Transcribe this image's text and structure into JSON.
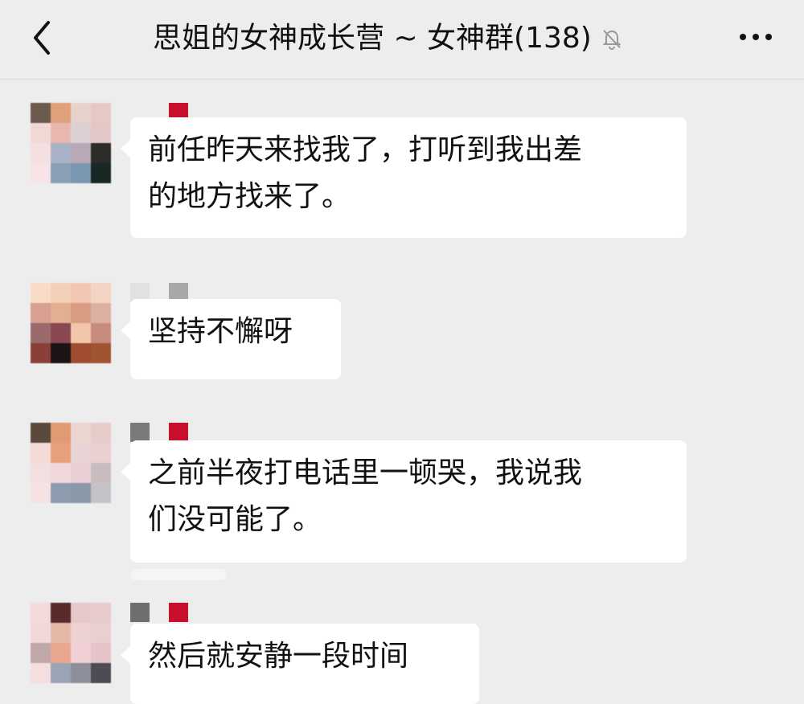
{
  "header": {
    "title": "思姐的女神成长营 ~ 女神群(138)",
    "back_icon": "chevron-left-icon",
    "mute_icon": "bell-off-icon",
    "more_icon": "more-horizontal-icon"
  },
  "messages": [
    {
      "text_lines": [
        "前任昨天来找我了，打听到我出差",
        "的地方找来了。"
      ]
    },
    {
      "text_lines": [
        "坚持不懈呀"
      ]
    },
    {
      "text_lines": [
        "之前半夜打电话里一顿哭，我说我",
        "们没可能了。"
      ]
    },
    {
      "text_lines": [
        "然后就安静一段时间"
      ]
    }
  ],
  "colors": {
    "background": "#ededed",
    "bubble": "#ffffff",
    "text": "#111111"
  }
}
